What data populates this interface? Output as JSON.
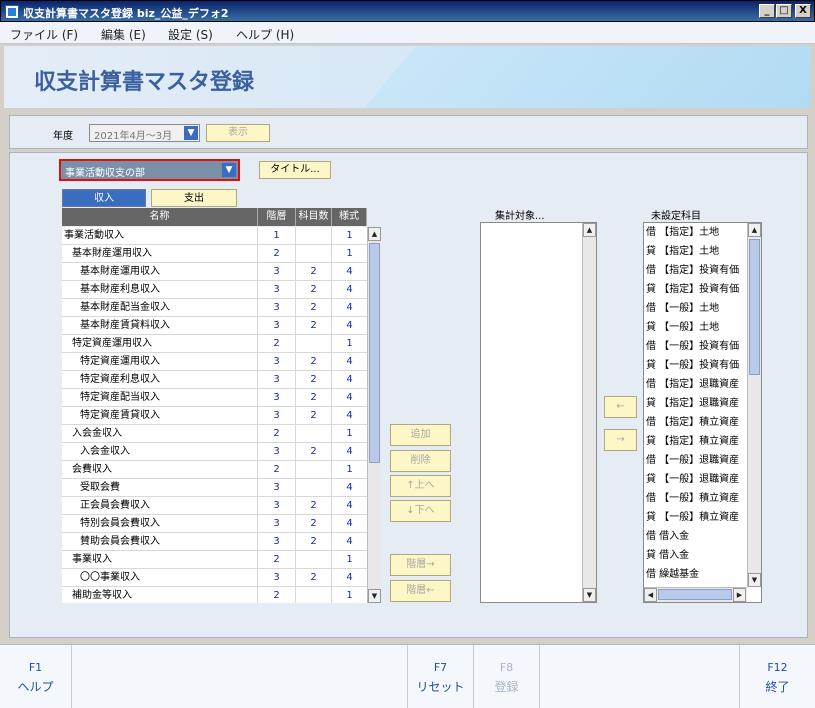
{
  "window": {
    "title": "収支計算書マスタ登録 biz_公益_デフォ2",
    "minimize": "_",
    "maximize": "□",
    "close": "X"
  },
  "menu": [
    "ファイル (F)",
    "編集 (E)",
    "設定 (S)",
    "ヘルプ (H)"
  ],
  "banner_title": "収支計算書マスタ登録",
  "year": {
    "label": "年度",
    "value": "2021年4月～3月",
    "show_button": "表示"
  },
  "category": {
    "value": "事業活動収支の部",
    "title_button": "タイトル..."
  },
  "tabs": {
    "income": "収入",
    "expense": "支出"
  },
  "table": {
    "headers": [
      "名称",
      "階層",
      "科目数",
      "様式"
    ],
    "rows": [
      {
        "name": "事業活動収入",
        "level": "1",
        "count": "",
        "style": "1",
        "indent": 0
      },
      {
        "name": "基本財産運用収入",
        "level": "2",
        "count": "",
        "style": "1",
        "indent": 1
      },
      {
        "name": "基本財産運用収入",
        "level": "3",
        "count": "2",
        "style": "4",
        "indent": 2
      },
      {
        "name": "基本財産利息収入",
        "level": "3",
        "count": "2",
        "style": "4",
        "indent": 2
      },
      {
        "name": "基本財産配当金収入",
        "level": "3",
        "count": "2",
        "style": "4",
        "indent": 2
      },
      {
        "name": "基本財産賃貸料収入",
        "level": "3",
        "count": "2",
        "style": "4",
        "indent": 2
      },
      {
        "name": "特定資産運用収入",
        "level": "2",
        "count": "",
        "style": "1",
        "indent": 1
      },
      {
        "name": "特定資産運用収入",
        "level": "3",
        "count": "2",
        "style": "4",
        "indent": 2
      },
      {
        "name": "特定資産利息収入",
        "level": "3",
        "count": "2",
        "style": "4",
        "indent": 2
      },
      {
        "name": "特定資産配当収入",
        "level": "3",
        "count": "2",
        "style": "4",
        "indent": 2
      },
      {
        "name": "特定資産賃貸収入",
        "level": "3",
        "count": "2",
        "style": "4",
        "indent": 2
      },
      {
        "name": "入会金収入",
        "level": "2",
        "count": "",
        "style": "1",
        "indent": 1
      },
      {
        "name": "入会金収入",
        "level": "3",
        "count": "2",
        "style": "4",
        "indent": 2
      },
      {
        "name": "会費収入",
        "level": "2",
        "count": "",
        "style": "1",
        "indent": 1
      },
      {
        "name": "受取会費",
        "level": "3",
        "count": "",
        "style": "4",
        "indent": 2
      },
      {
        "name": "正会員会費収入",
        "level": "3",
        "count": "2",
        "style": "4",
        "indent": 2
      },
      {
        "name": "特別会員会費収入",
        "level": "3",
        "count": "2",
        "style": "4",
        "indent": 2
      },
      {
        "name": "賛助会員会費収入",
        "level": "3",
        "count": "2",
        "style": "4",
        "indent": 2
      },
      {
        "name": "事業収入",
        "level": "2",
        "count": "",
        "style": "1",
        "indent": 1
      },
      {
        "name": "〇〇事業収入",
        "level": "3",
        "count": "2",
        "style": "4",
        "indent": 2
      },
      {
        "name": "補助金等収入",
        "level": "2",
        "count": "",
        "style": "1",
        "indent": 1
      }
    ]
  },
  "mid_buttons": {
    "add": "追加",
    "delete": "削除",
    "up": "↑上へ",
    "down": "↓下へ",
    "level_right": "階層→",
    "level_left": "階層←"
  },
  "aggregate_label": "集計対象...",
  "unset_label": "未設定科目",
  "arrows": {
    "left": "←",
    "right": "→"
  },
  "unset_items": [
    "借 【指定】土地",
    "貸 【指定】土地",
    "借 【指定】投資有価",
    "貸 【指定】投資有価",
    "借 【一般】土地",
    "貸 【一般】土地",
    "借 【一般】投資有価",
    "貸 【一般】投資有価",
    "借 【指定】退職資産",
    "貸 【指定】退職資産",
    "借 【指定】積立資産",
    "貸 【指定】積立資産",
    "借 【一般】退職資産",
    "貸 【一般】退職資産",
    "借 【一般】積立資産",
    "貸 【一般】積立資産",
    "借 借入金",
    "貸 借入金",
    "借 繰越基金"
  ],
  "footer": [
    {
      "key": "F1",
      "label": "ヘルプ",
      "disabled": false
    },
    {
      "key": "F7",
      "label": "リセット",
      "disabled": false
    },
    {
      "key": "F8",
      "label": "登録",
      "disabled": true
    },
    {
      "key": "F12",
      "label": "終了",
      "disabled": false
    }
  ]
}
